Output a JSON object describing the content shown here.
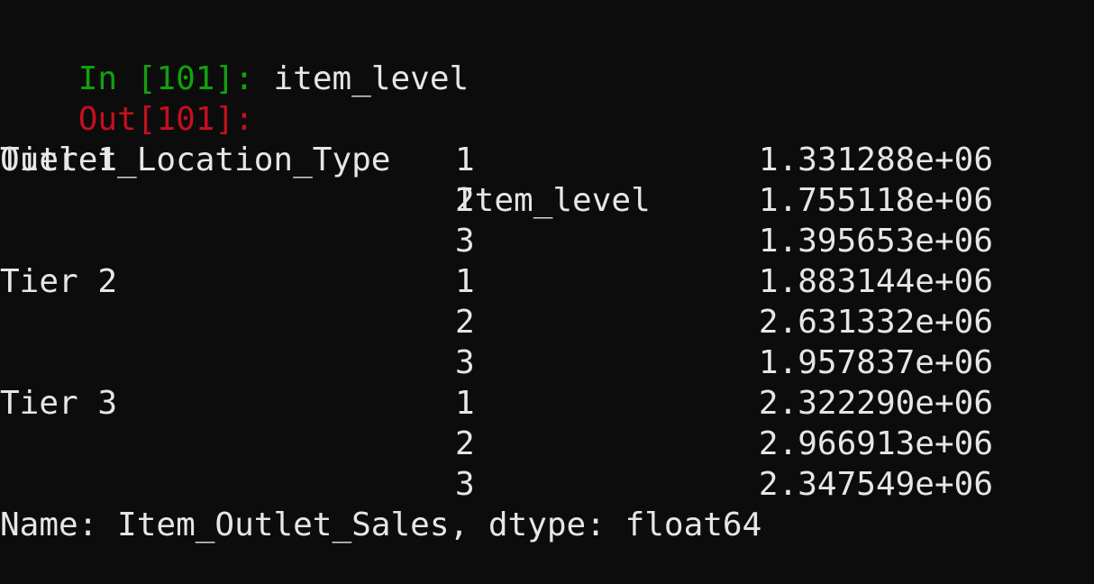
{
  "colors": {
    "background": "#0c0c0c",
    "text": "#e6e6e6",
    "in_prompt": "#13a10e",
    "out_prompt": "#c50f1f"
  },
  "input": {
    "prompt": "In [101]:",
    "code": "item_level"
  },
  "output": {
    "prompt": "Out[101]:",
    "header_index": "Outlet_Location_Type",
    "header_level": "Item_level",
    "rows": [
      {
        "tier": "Tier 1",
        "level": "1",
        "value": "1.331288e+06"
      },
      {
        "tier": "",
        "level": "2",
        "value": "1.755118e+06"
      },
      {
        "tier": "",
        "level": "3",
        "value": "1.395653e+06"
      },
      {
        "tier": "Tier 2",
        "level": "1",
        "value": "1.883144e+06"
      },
      {
        "tier": "",
        "level": "2",
        "value": "2.631332e+06"
      },
      {
        "tier": "",
        "level": "3",
        "value": "1.957837e+06"
      },
      {
        "tier": "Tier 3",
        "level": "1",
        "value": "2.322290e+06"
      },
      {
        "tier": "",
        "level": "2",
        "value": "2.966913e+06"
      },
      {
        "tier": "",
        "level": "3",
        "value": "2.347549e+06"
      }
    ],
    "footer": "Name: Item_Outlet_Sales, dtype: float64"
  }
}
